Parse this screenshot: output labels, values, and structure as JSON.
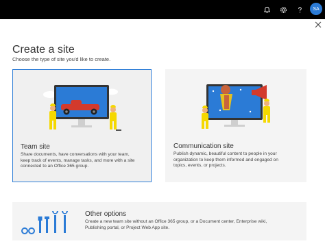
{
  "topbar": {
    "icons": [
      "bell-icon",
      "gear-icon",
      "help-icon"
    ],
    "avatar_initials": "SA"
  },
  "header": {
    "title": "Create a site",
    "subtitle": "Choose the type of site you'd like to create."
  },
  "cards": {
    "team": {
      "title": "Team site",
      "line1": "Share documents, have conversations with your team,",
      "line2": "keep track of events, manage tasks, and more with a site",
      "line3": "connected to an Office 365 group."
    },
    "communication": {
      "title": "Communication site",
      "line1": "Publish dynamic, beautiful content to people in your",
      "line2": "organization to keep them informed and engaged on",
      "line3": "topics, events, or projects."
    },
    "other": {
      "title": "Other options",
      "line1": "Create a new team site without an Office 365 group, or a Document center, Enterprise wiki,",
      "line2": "Publishing portal, or Project Web App site."
    }
  },
  "colors": {
    "accent": "#2b7bd6",
    "topbar": "#000000",
    "card_bg": "#f4f4f4"
  }
}
